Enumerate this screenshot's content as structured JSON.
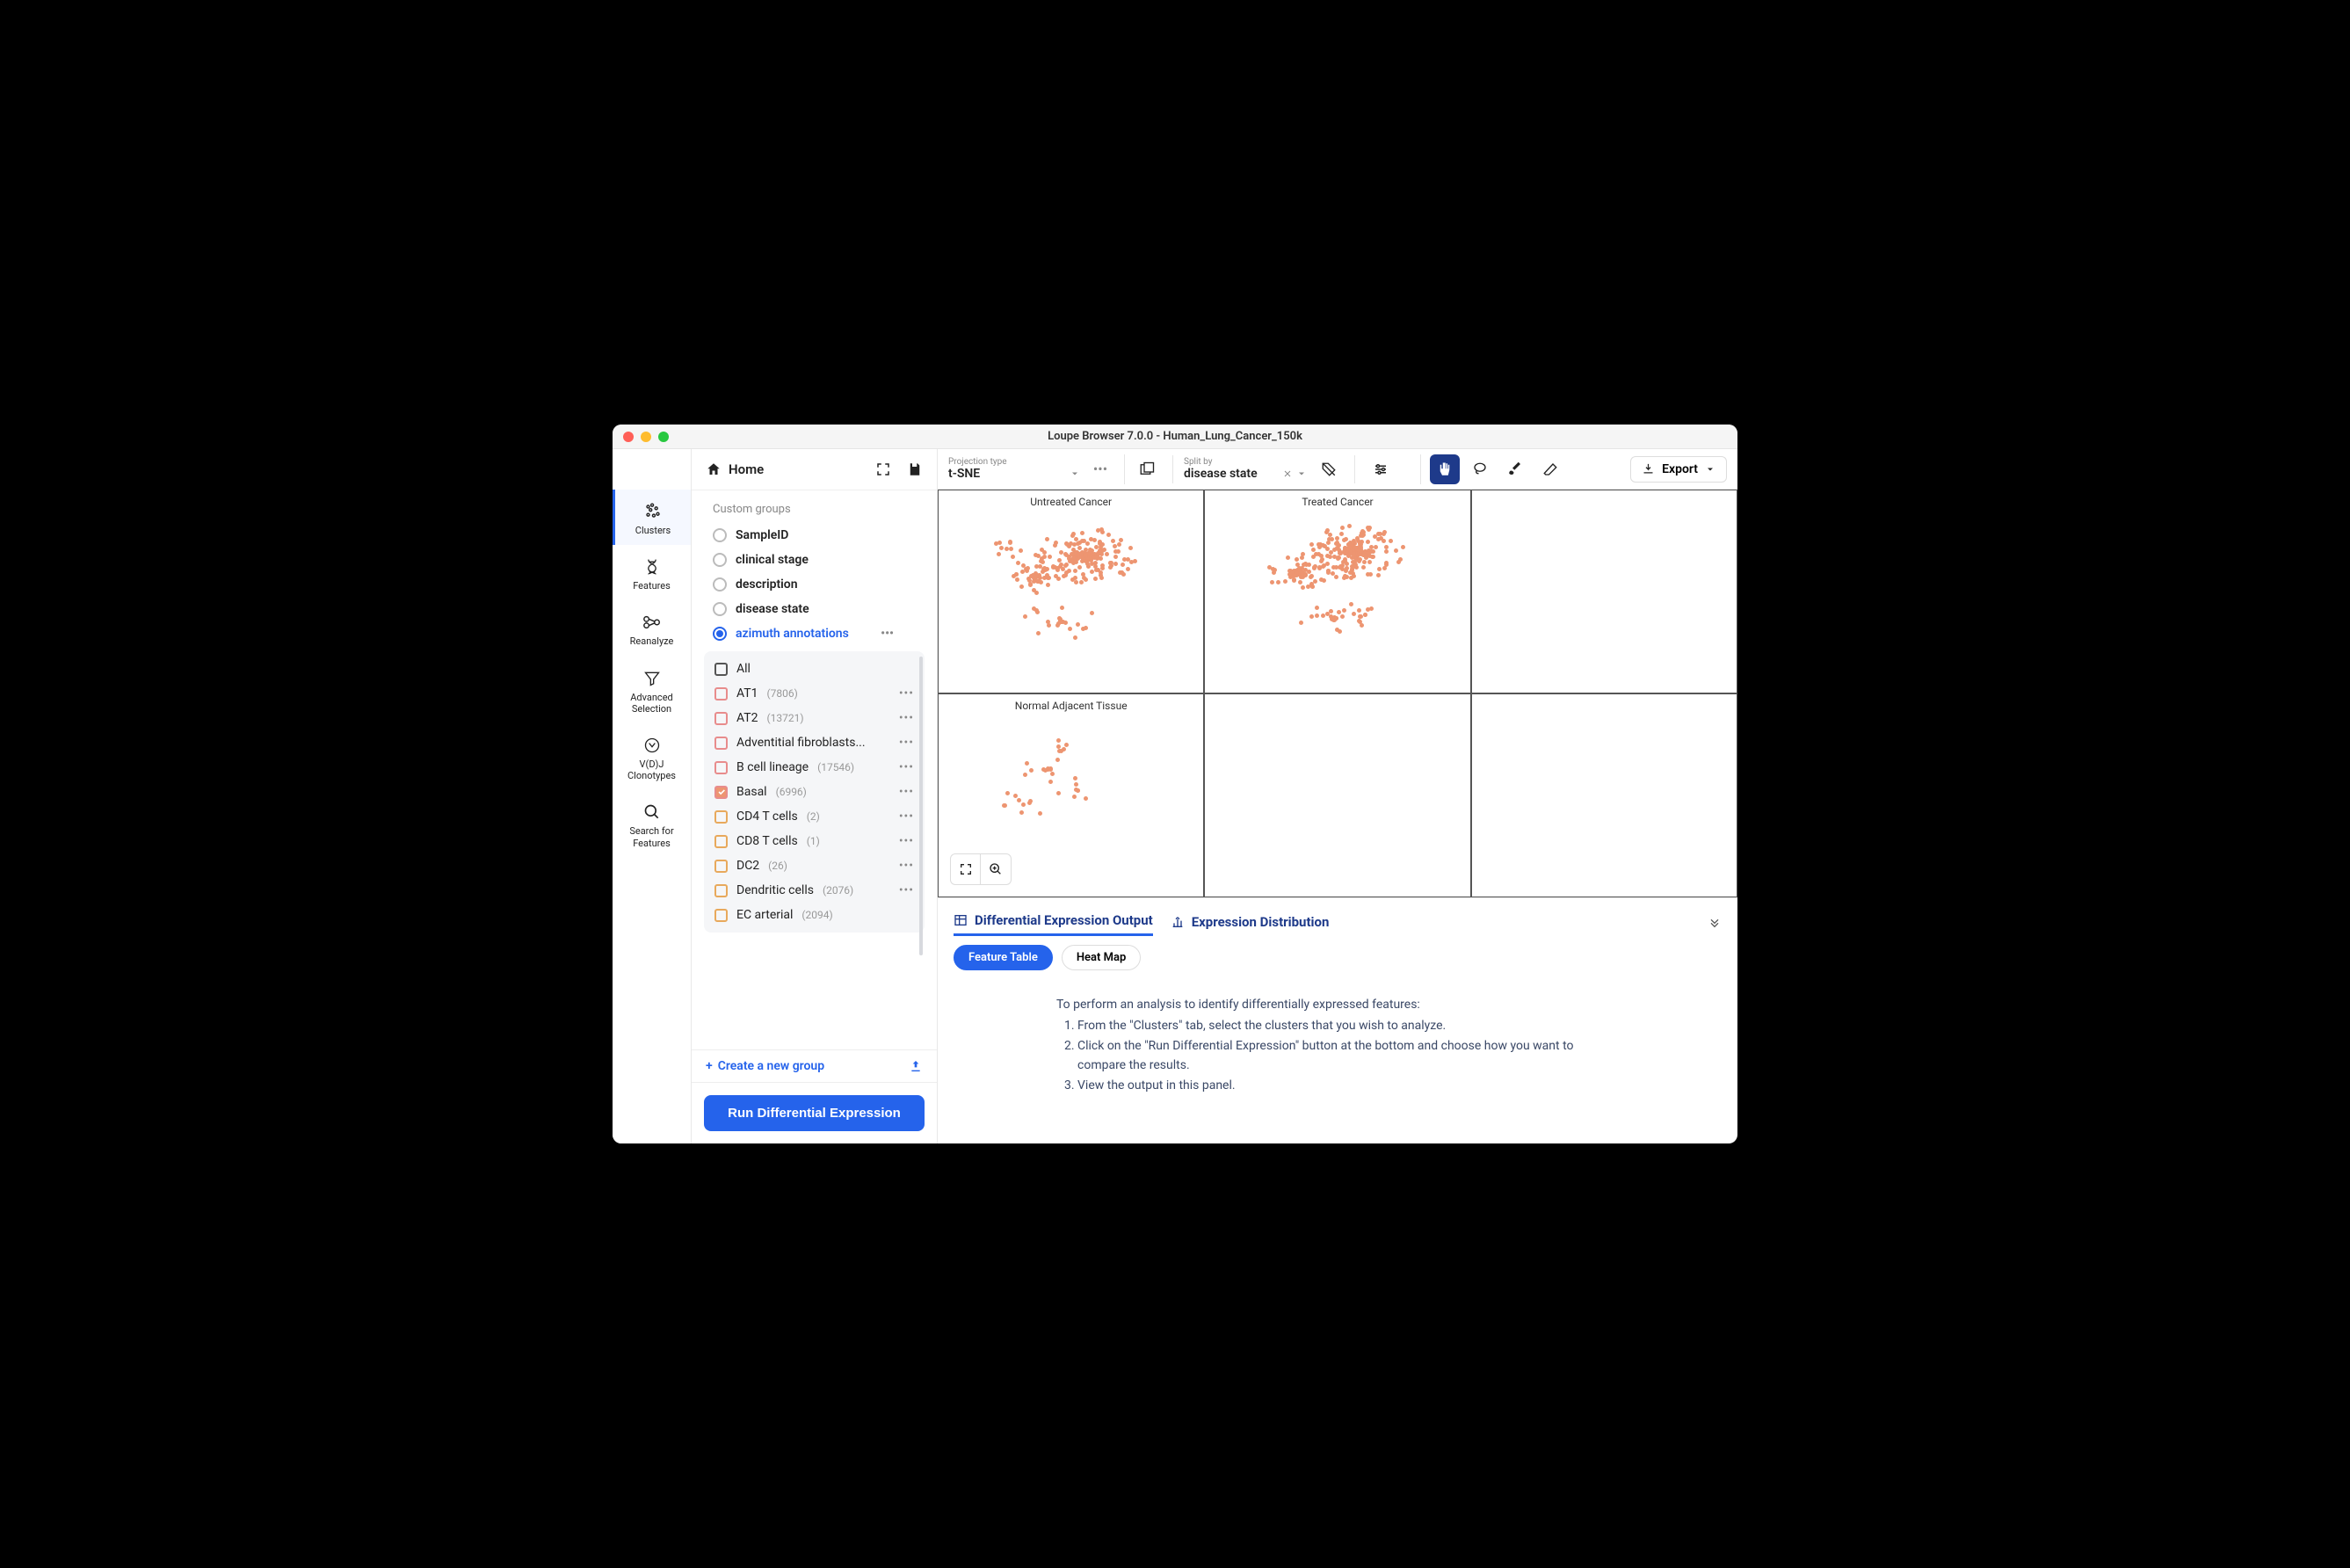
{
  "window": {
    "title": "Loupe Browser 7.0.0 - Human_Lung_Cancer_150k"
  },
  "panel_top": {
    "home": "Home"
  },
  "sidebar_nav": {
    "items": [
      {
        "label": "Clusters"
      },
      {
        "label": "Features"
      },
      {
        "label": "Reanalyze"
      },
      {
        "label": "Advanced Selection"
      },
      {
        "label": "V(D)J Clonotypes"
      },
      {
        "label": "Search for Features"
      }
    ]
  },
  "groups": {
    "section_label": "Custom groups",
    "items": [
      {
        "label": "SampleID"
      },
      {
        "label": "clinical stage"
      },
      {
        "label": "description"
      },
      {
        "label": "disease state"
      },
      {
        "label": "azimuth annotations",
        "selected": true
      }
    ]
  },
  "clusters": {
    "all_label": "All",
    "items": [
      {
        "label": "AT1",
        "count": "(7806)",
        "color": "#e88c8c"
      },
      {
        "label": "AT2",
        "count": "(13721)",
        "color": "#e88c8c"
      },
      {
        "label": "Adventitial fibroblasts...",
        "count": "",
        "color": "#e88c8c"
      },
      {
        "label": "B cell lineage",
        "count": "(17546)",
        "color": "#e88c8c"
      },
      {
        "label": "Basal",
        "count": "(6996)",
        "color": "#e88c8c",
        "checked": true
      },
      {
        "label": "CD4 T cells",
        "count": "(2)",
        "color": "#e8a95c"
      },
      {
        "label": "CD8 T cells",
        "count": "(1)",
        "color": "#e8a95c"
      },
      {
        "label": "DC2",
        "count": "(26)",
        "color": "#e8a95c"
      },
      {
        "label": "Dendritic cells",
        "count": "(2076)",
        "color": "#e8a95c"
      },
      {
        "label": "EC arterial",
        "count": "(2094)",
        "color": "#e8a95c"
      }
    ]
  },
  "create_group": "Create a new group",
  "run_de": "Run Differential Expression",
  "toolbar": {
    "projection_label": "Projection type",
    "projection_value": "t-SNE",
    "split_label": "Split by",
    "split_value": "disease state",
    "export": "Export"
  },
  "plots": {
    "titles": [
      "Untreated Cancer",
      "Treated Cancer",
      "Normal Adjacent Tissue"
    ]
  },
  "bottom": {
    "tab1": "Differential Expression Output",
    "tab2": "Expression Distribution",
    "pill1": "Feature Table",
    "pill2": "Heat Map",
    "help_lead": "To perform an analysis to identify differentially expressed features:",
    "help_1": "From the \"Clusters\" tab, select the clusters that you wish to analyze.",
    "help_2": "Click on the \"Run Differential Expression\" button at the bottom and choose how you want to compare the results.",
    "help_3": "View the output in this panel."
  }
}
